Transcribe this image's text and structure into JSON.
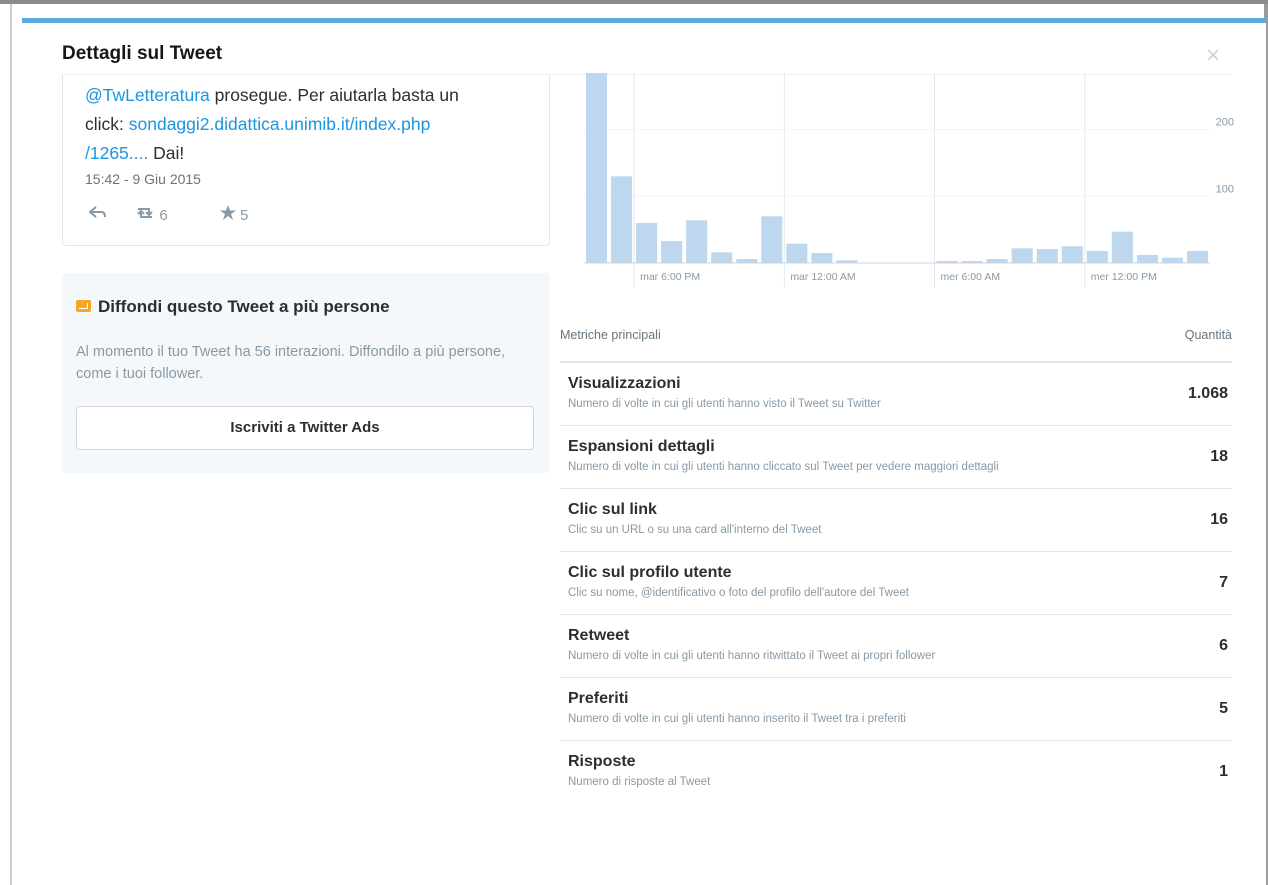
{
  "modal": {
    "title": "Dettagli sul Tweet",
    "close_glyph": "×"
  },
  "tweet": {
    "text_line1_mention": "@TwLetteratura",
    "text_line1_rest": " prosegue. Per aiutarla basta un",
    "text_line2_prefix": "click: ",
    "link_part1": "sondaggi2.didattica.unimib.it/index.php",
    "link_part2": "/1265....",
    "text_line3_suffix": " Dai!",
    "timestamp": "15:42 - 9 Giu 2015",
    "retweet_count": "6",
    "favorite_count": "5",
    "icons": {
      "reply": "reply-icon",
      "retweet": "retweet-icon",
      "favorite": "star-icon"
    }
  },
  "promote": {
    "title": "Diffondi questo Tweet a più persone",
    "description": "Al momento il tuo Tweet ha 56 interazioni. Diffondilo a più persone, come i tuoi follower.",
    "button_label": "Iscriviti a Twitter Ads"
  },
  "chart_data": {
    "type": "bar",
    "values": [
      285,
      130,
      60,
      33,
      64,
      16,
      6,
      70,
      29,
      15,
      4,
      0,
      0,
      0,
      3,
      3,
      6,
      22,
      21,
      25,
      18,
      47,
      12,
      8,
      18
    ],
    "ylim": [
      0,
      240
    ],
    "yticks": [
      100,
      200
    ],
    "xtick_labels": [
      "mar 6:00 PM",
      "mar 12:00 AM",
      "mer 6:00 AM",
      "mer 12:00 PM"
    ],
    "xtick_positions": [
      2,
      8,
      14,
      20
    ],
    "bar_color": "#bdd7ee",
    "grid": true
  },
  "metrics": {
    "header_left": "Metriche principali",
    "header_right": "Quantità",
    "rows": [
      {
        "name": "Visualizzazioni",
        "desc": "Numero di volte in cui gli utenti hanno visto il Tweet su Twitter",
        "value": "1.068"
      },
      {
        "name": "Espansioni dettagli",
        "desc": "Numero di volte in cui gli utenti hanno cliccato sul Tweet per vedere maggiori dettagli",
        "value": "18"
      },
      {
        "name": "Clic sul link",
        "desc": "Clic su un URL o su una card all'interno del Tweet",
        "value": "16"
      },
      {
        "name": "Clic sul profilo utente",
        "desc": "Clic su nome, @identificativo o foto del profilo dell'autore del Tweet",
        "value": "7"
      },
      {
        "name": "Retweet",
        "desc": "Numero di volte in cui gli utenti hanno ritwittato il Tweet ai propri follower",
        "value": "6"
      },
      {
        "name": "Preferiti",
        "desc": "Numero di volte in cui gli utenti hanno inserito il Tweet tra i preferiti",
        "value": "5"
      },
      {
        "name": "Risposte",
        "desc": "Numero di risposte al Tweet",
        "value": "1"
      }
    ]
  }
}
